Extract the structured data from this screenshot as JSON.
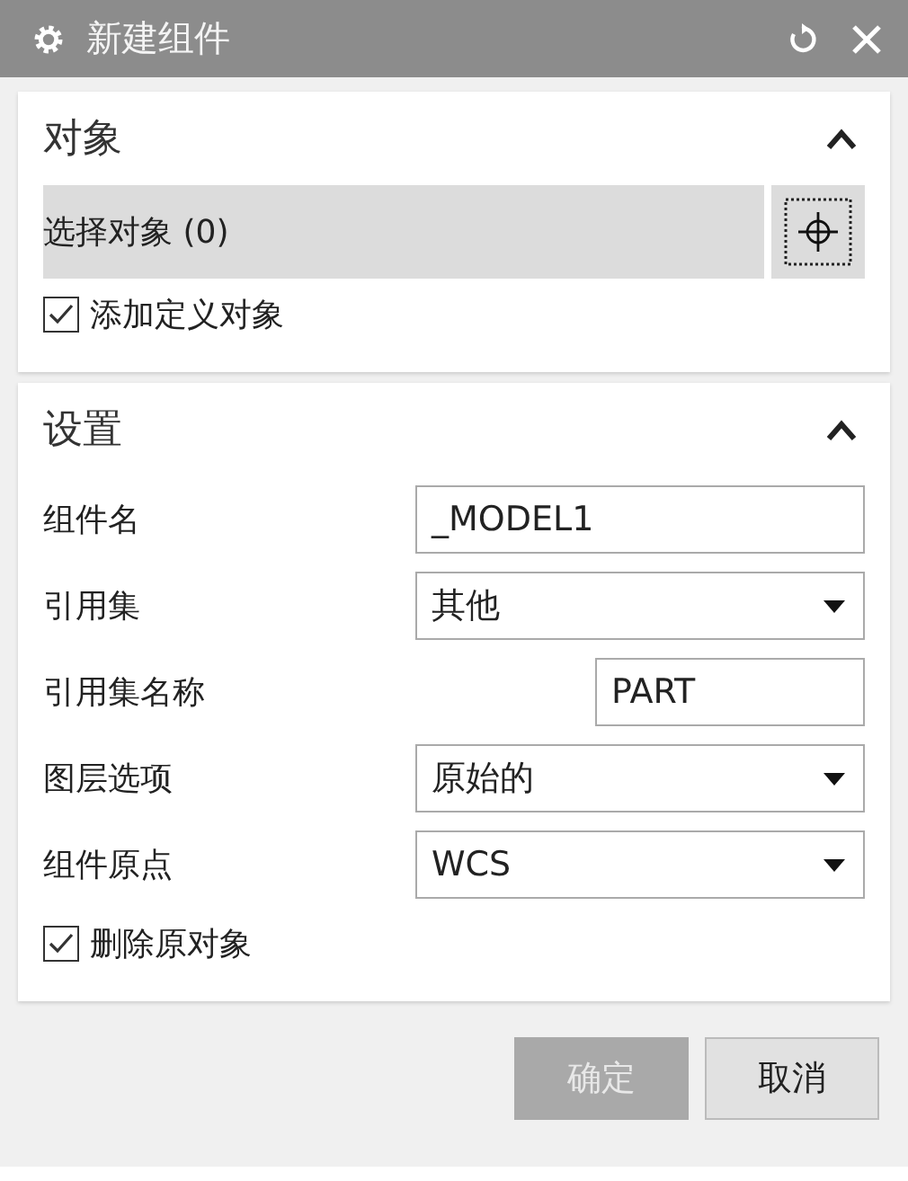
{
  "window": {
    "title": "新建组件"
  },
  "sections": [
    {
      "title": "对象",
      "expanded": true,
      "kind": "object",
      "select": {
        "label": "选择对象 (0)"
      },
      "checkbox": {
        "label": "添加定义对象",
        "checked": true
      }
    },
    {
      "title": "设置",
      "expanded": true,
      "kind": "settings",
      "fields": [
        {
          "label": "组件名",
          "kind": "text",
          "value": "_MODEL1"
        },
        {
          "label": "引用集",
          "kind": "dropdown",
          "value": "其他"
        },
        {
          "label": "引用集名称",
          "kind": "short-text",
          "value": "PART"
        },
        {
          "label": "图层选项",
          "kind": "dropdown",
          "value": "原始的"
        },
        {
          "label": "组件原点",
          "kind": "dropdown",
          "value": "WCS"
        }
      ],
      "checkbox": {
        "label": "删除原对象",
        "checked": true
      }
    }
  ],
  "buttons": [
    {
      "label": "确定",
      "disabled": true
    },
    {
      "label": "取消",
      "disabled": false
    }
  ]
}
